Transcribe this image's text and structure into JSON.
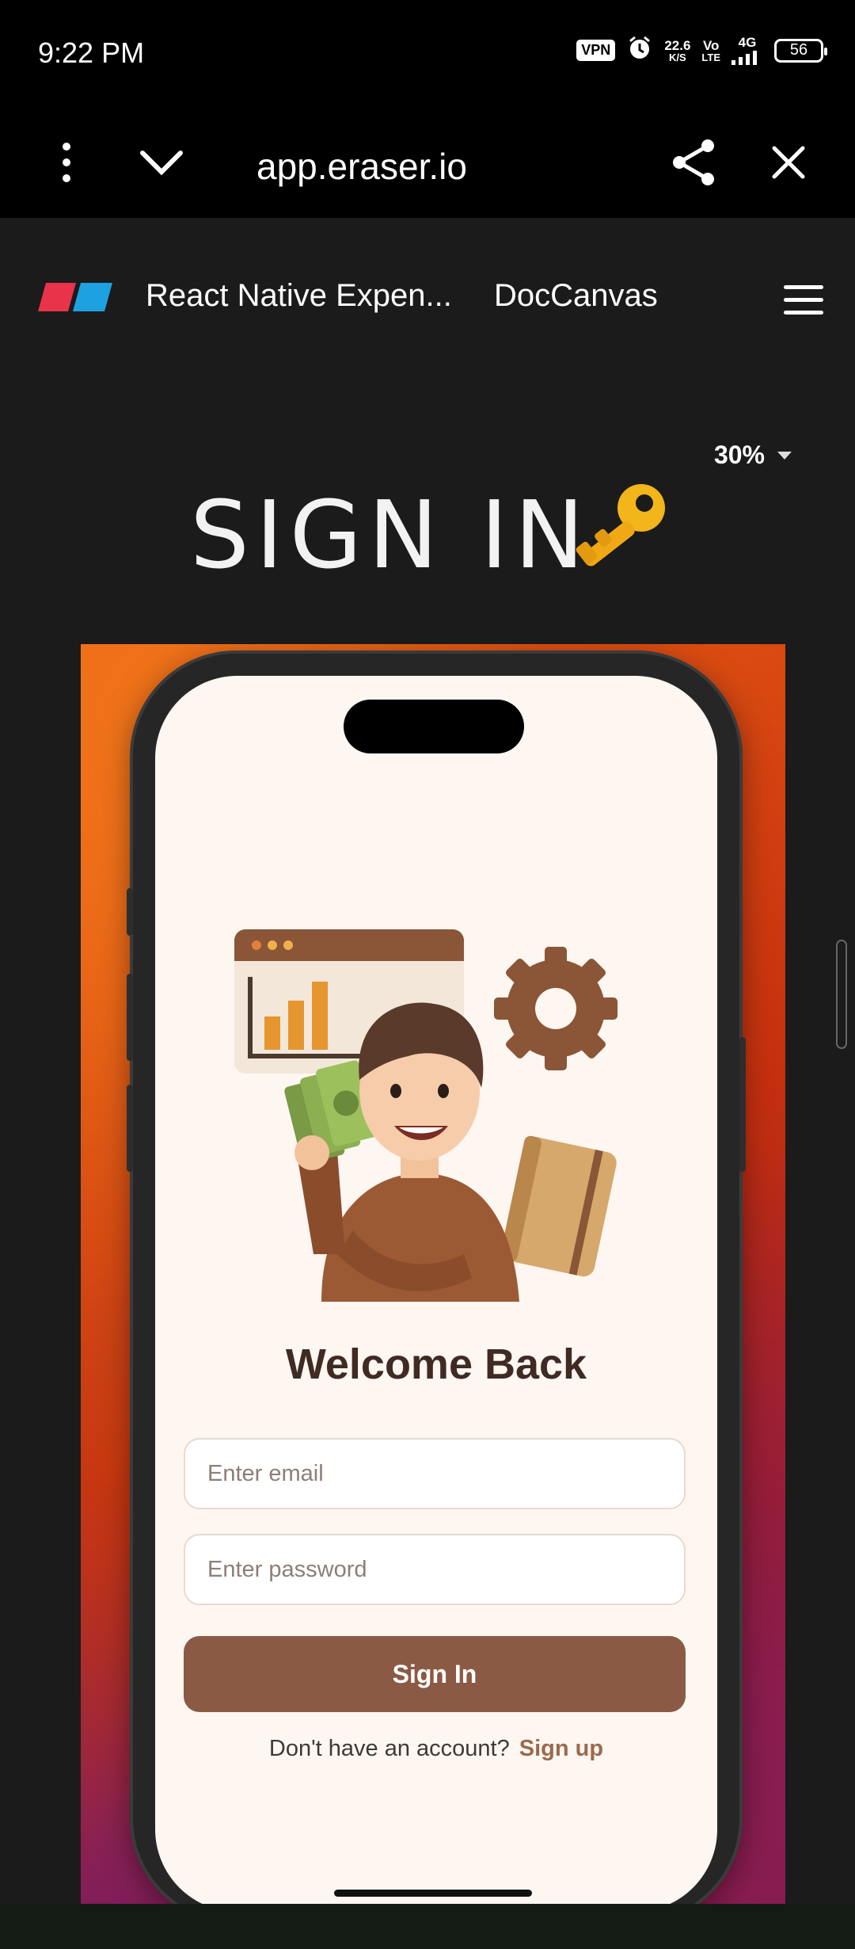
{
  "status_bar": {
    "time": "9:22 PM",
    "vpn": "VPN",
    "speed_value": "22.6",
    "speed_unit": "K/S",
    "volte_top": "Vo",
    "volte_bottom": "LTE",
    "network": "4G",
    "battery": "56"
  },
  "browser": {
    "url": "app.eraser.io"
  },
  "site": {
    "project_title": "React Native Expen...",
    "doc_title": "DocCanvas"
  },
  "canvas": {
    "zoom": "30%",
    "heading": "SIGN IN",
    "key_emoji": "key-icon"
  },
  "phone_app": {
    "welcome": "Welcome Back",
    "email_placeholder": "Enter email",
    "password_placeholder": "Enter password",
    "signin_label": "Sign In",
    "signup_prompt": "Don't have an account?",
    "signup_link": "Sign up"
  },
  "colors": {
    "accent_brown": "#8b5a44",
    "screen_bg": "#fdf6f1",
    "heading_text": "#3f2a24",
    "page_bg": "#1b1b1b"
  }
}
